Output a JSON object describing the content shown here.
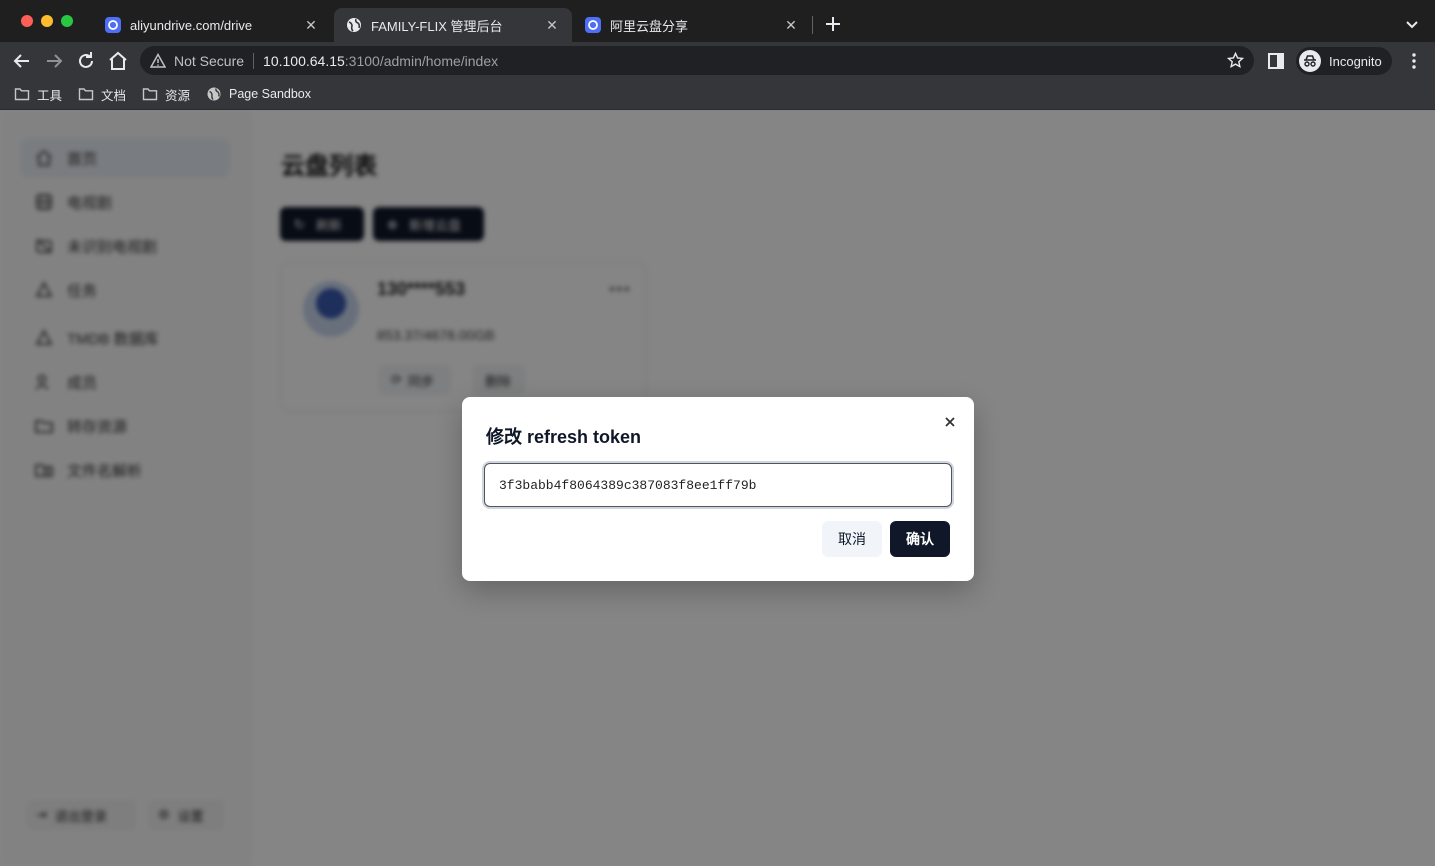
{
  "browser": {
    "tabs": [
      {
        "title": "aliyundrive.com/drive",
        "favicon": "aliyun-drive-icon"
      },
      {
        "title": "FAMILY-FLIX 管理后台",
        "favicon": "globe-icon",
        "active": true
      },
      {
        "title": "阿里云盘分享",
        "favicon": "aliyun-drive-icon"
      }
    ],
    "address": {
      "security_label": "Not Secure",
      "host": "10.100.64.15",
      "path": ":3100/admin/home/index"
    },
    "profile_label": "Incognito",
    "bookmarks": [
      {
        "label": "工具",
        "icon": "folder-icon"
      },
      {
        "label": "文档",
        "icon": "folder-icon"
      },
      {
        "label": "资源",
        "icon": "folder-icon"
      },
      {
        "label": "Page Sandbox",
        "icon": "globe-icon"
      }
    ]
  },
  "sidebar": {
    "items": [
      {
        "label": "首页",
        "icon": "home-icon",
        "active": true
      },
      {
        "label": "电视剧",
        "icon": "film-icon"
      },
      {
        "label": "未识别电视剧",
        "icon": "tv-off-icon"
      },
      {
        "label": "任务",
        "icon": "task-icon"
      },
      {
        "label": "TMDB 数据库",
        "icon": "database-icon"
      },
      {
        "label": "成员",
        "icon": "users-icon"
      },
      {
        "label": "转存资源",
        "icon": "transfer-icon"
      },
      {
        "label": "文件名解析",
        "icon": "file-search-icon"
      }
    ],
    "bottom": {
      "logout": "退出登录",
      "settings": "设置"
    }
  },
  "main": {
    "title": "云盘列表",
    "refresh_label": "刷新",
    "add_label": "新增云盘",
    "card": {
      "account": "130****553",
      "space": "853.37/4678.00GB",
      "sync_label": "同步",
      "delete_label": "删除"
    }
  },
  "modal": {
    "title": "修改 refresh token",
    "token_value": "3f3babb4f8064389c387083f8ee1ff79b",
    "cancel_label": "取消",
    "confirm_label": "确认"
  },
  "colors": {
    "primary": "#0f1729",
    "chrome_bg": "#35363a",
    "overlay": "rgba(0,0,0,0.48)"
  }
}
